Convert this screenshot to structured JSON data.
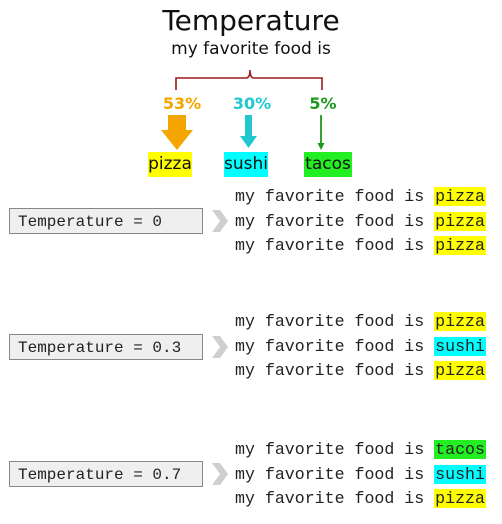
{
  "header": {
    "title": "Temperature",
    "prompt": "my favorite food is"
  },
  "options": [
    {
      "word": "pizza",
      "percent": "53%",
      "color": "#ffff00",
      "arrow_color": "#f5a500"
    },
    {
      "word": "sushi",
      "percent": "30%",
      "color": "#00ffff",
      "arrow_color": "#22c8d0"
    },
    {
      "word": "tacos",
      "percent": "5%",
      "color": "#22ee22",
      "arrow_color": "#1a9a1a"
    }
  ],
  "bracket_color": "#9b1c1c",
  "groups": [
    {
      "label": "Temperature = 0",
      "prefix": "my favorite food is",
      "outputs": [
        {
          "word": "pizza",
          "color": "#ffff00"
        },
        {
          "word": "pizza",
          "color": "#ffff00"
        },
        {
          "word": "pizza",
          "color": "#ffff00"
        }
      ]
    },
    {
      "label": "Temperature = 0.3",
      "prefix": "my favorite food is",
      "outputs": [
        {
          "word": "pizza",
          "color": "#ffff00"
        },
        {
          "word": "sushi",
          "color": "#00ffff"
        },
        {
          "word": "pizza",
          "color": "#ffff00"
        }
      ]
    },
    {
      "label": "Temperature = 0.7",
      "prefix": "my favorite food is",
      "outputs": [
        {
          "word": "tacos",
          "color": "#22ee22"
        },
        {
          "word": "sushi",
          "color": "#00ffff"
        },
        {
          "word": "pizza",
          "color": "#ffff00"
        }
      ]
    }
  ]
}
